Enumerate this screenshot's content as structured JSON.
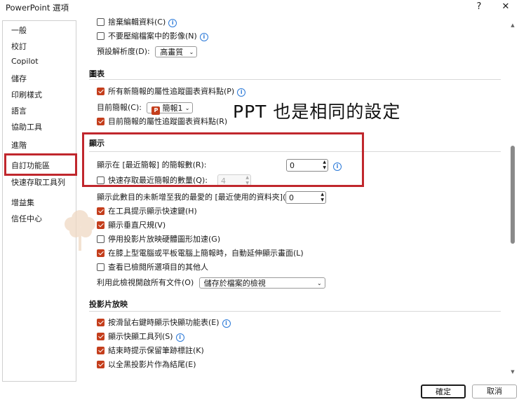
{
  "window": {
    "title": "PowerPoint 選項",
    "help": "?",
    "close": "✕"
  },
  "sidebar": {
    "items": [
      {
        "label": "一般"
      },
      {
        "label": "校訂"
      },
      {
        "label": "Copilot"
      },
      {
        "label": "儲存"
      },
      {
        "label": "印刷樣式"
      },
      {
        "label": "語言"
      },
      {
        "label": "協助工具"
      },
      {
        "label": "進階",
        "selected": true
      },
      {
        "label": "自訂功能區"
      },
      {
        "label": "快速存取工具列"
      },
      {
        "label": "增益集"
      },
      {
        "label": "信任中心"
      }
    ]
  },
  "image_section": {
    "row1": "捨棄編輯資料(C)",
    "row2": "不要壓縮檔案中的影像(N)",
    "resolution_label": "預設解析度(D):",
    "resolution_value": "高畫質"
  },
  "chart_section": {
    "heading": "圖表",
    "row1": "所有新簡報的屬性追蹤圖表資料點(P)",
    "current_label": "目前簡報(C):",
    "current_value": "簡報1",
    "row2": "目前簡報的屬性追蹤圖表資料點(R)"
  },
  "display_section": {
    "heading": "顯示",
    "recent_count_label": "顯示在 [最近簡報] 的簡報數(R):",
    "recent_count_value": "0",
    "quick_access_label": "快速存取最近簡報的數量(Q):",
    "quick_access_value": "4",
    "unpinned_label": "顯示此數目的未新增至我的最愛的 [最近使用的資料夾](F):",
    "unpinned_value": "0",
    "opt1": "在工具提示顯示快速鍵(H)",
    "opt2": "顯示垂直尺規(V)",
    "opt3": "停用投影片放映硬體圖形加速(G)",
    "opt4": "在膝上型電腦或平板電腦上簡報時，自動延伸顯示畫面(L)",
    "opt5": "查看已檢閱所選項目的其他人",
    "view_label": "利用此檢視開啟所有文件(O)",
    "view_value": "儲存於檔案的檢視"
  },
  "slideshow_section": {
    "heading": "投影片放映",
    "opt1": "按滑鼠右鍵時顯示快顯功能表(E)",
    "opt2": "顯示快顯工具列(S)",
    "opt3": "結束時提示保留筆跡標註(K)",
    "opt4": "以全黑投影片作為結尾(E)"
  },
  "annotation": {
    "text": "PPT 也是相同的設定"
  },
  "footer": {
    "ok": "確定",
    "cancel": "取消"
  },
  "colors": {
    "accent": "#c43e1c",
    "highlight": "#c0272d",
    "info": "#2b79d8"
  }
}
